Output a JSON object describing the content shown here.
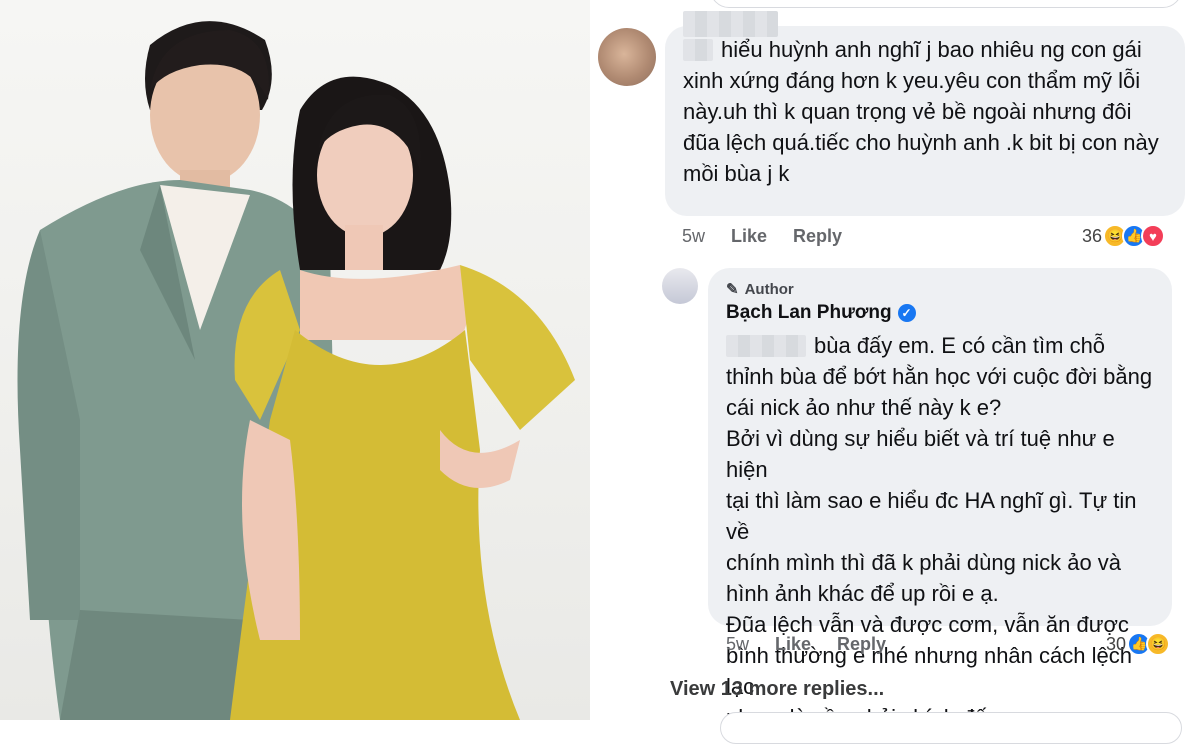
{
  "photo": {
    "alt_people": [
      "man-in-suit",
      "woman-in-yellow-dress"
    ]
  },
  "comment1": {
    "lines": [
      "hiểu huỳnh anh nghĩ j bao nhiêu ng con gái",
      "xinh xứng đáng hơn k yeu.yêu con thẩm mỹ lỗi",
      "này.uh thì k quan trọng vẻ bề ngoài nhưng đôi",
      "đũa lệch quá.tiếc cho huỳnh anh .k bit bị con này",
      "mồi bùa j k"
    ],
    "time": "5w",
    "like": "Like",
    "reply": "Reply",
    "reaction_count": "36"
  },
  "reply1": {
    "author_tag": "Author",
    "author_name": "Bạch Lan Phương",
    "lines": [
      "bùa đấy em. E có cần tìm chỗ",
      "thỉnh bùa để bớt hằn học với cuộc đời bằng",
      "cái nick ảo như thế này k e?",
      "Bởi vì dùng sự hiểu biết và trí tuệ như e hiện",
      "tại thì làm sao e hiểu đc HA nghĩ gì. Tự tin về",
      "chính mình thì đã k phải dùng nick ảo và",
      "hình ảnh khác để up rồi e ạ.",
      "Đũa lệch vẫn và được cơm, vẫn ăn được",
      "bình thường e nhé nhưng nhân cách lệch lạc",
      "như e là cần phải chính đấy e."
    ],
    "time": "5w",
    "like": "Like",
    "reply": "Reply",
    "reaction_count": "30"
  },
  "view_more": "View 13 more replies...",
  "colors": {
    "like_blue": "#1877f2",
    "love_red": "#f33e58",
    "haha_yellow": "#f7b928",
    "bubble": "#eef0f3"
  }
}
